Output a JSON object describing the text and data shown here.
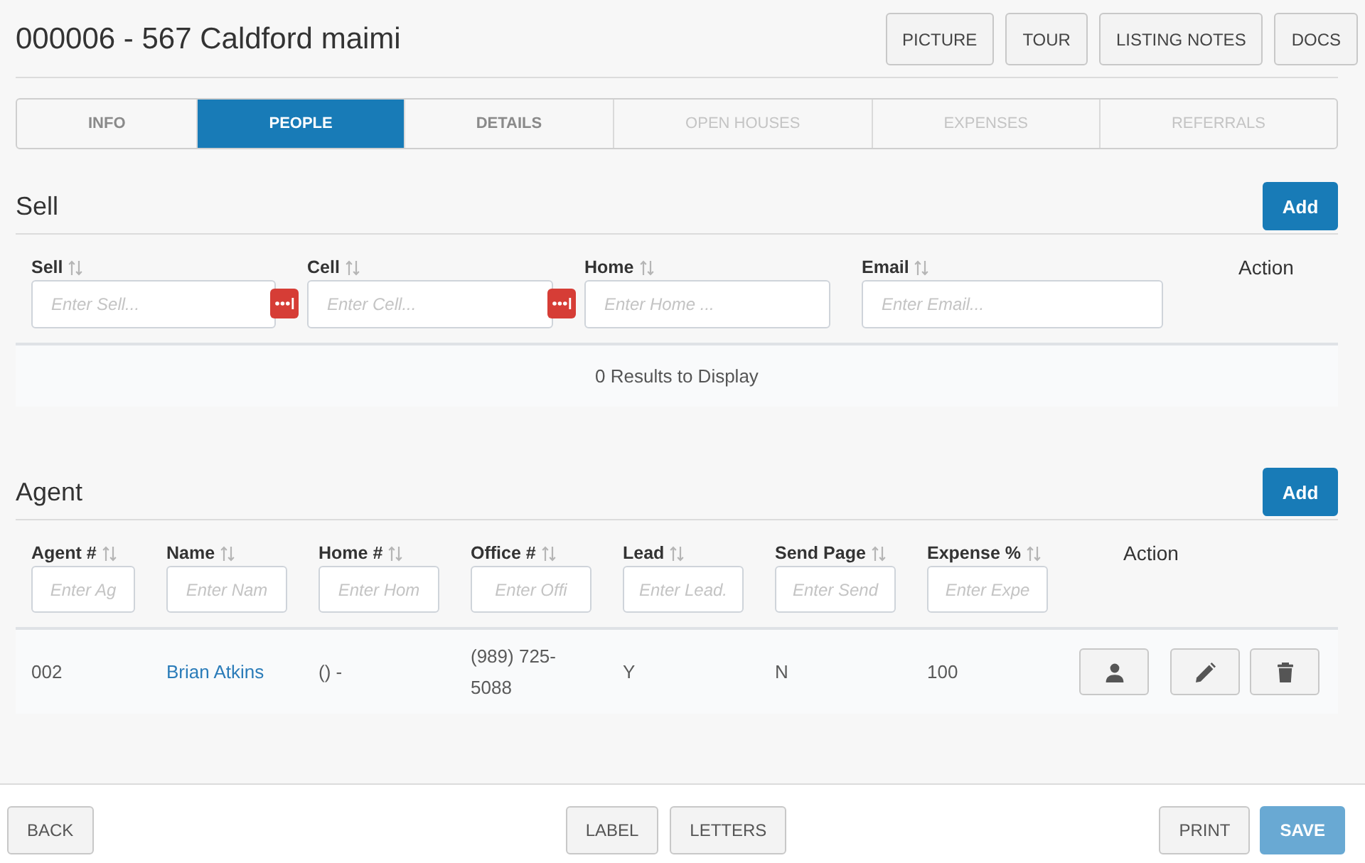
{
  "header": {
    "title": "000006 - 567 Caldford maimi",
    "buttons": [
      {
        "label": "PICTURE"
      },
      {
        "label": "TOUR"
      },
      {
        "label": "LISTING NOTES"
      },
      {
        "label": "DOCS"
      }
    ]
  },
  "tabs": [
    {
      "label": "INFO",
      "selected": false,
      "disabled": false
    },
    {
      "label": "PEOPLE",
      "selected": true,
      "disabled": false
    },
    {
      "label": "DETAILS",
      "selected": false,
      "disabled": false
    },
    {
      "label": "OPEN HOUSES",
      "selected": false,
      "disabled": true
    },
    {
      "label": "EXPENSES",
      "selected": false,
      "disabled": true
    },
    {
      "label": "REFERRALS",
      "selected": false,
      "disabled": true
    }
  ],
  "sell_section": {
    "title": "Sell",
    "add_button": "Add",
    "columns": [
      {
        "kind": "filter",
        "label": "Sell",
        "placeholder": "Enter Sell...",
        "addon": true
      },
      {
        "kind": "filter",
        "label": "Cell",
        "placeholder": "Enter Cell...",
        "addon": true
      },
      {
        "kind": "filter",
        "label": "Home",
        "placeholder": "Enter Home ...",
        "addon": false
      },
      {
        "kind": "filter",
        "label": "Email",
        "placeholder": "Enter Email...",
        "addon": false
      },
      {
        "kind": "action",
        "label": "Action"
      }
    ],
    "empty_message": "0 Results to Display"
  },
  "agent_section": {
    "title": "Agent",
    "add_button": "Add",
    "columns": [
      {
        "kind": "filter",
        "label": "Agent #",
        "placeholder": "Enter Ag",
        "addon": false
      },
      {
        "kind": "filter",
        "label": "Name",
        "placeholder": "Enter Nam",
        "addon": false
      },
      {
        "kind": "filter",
        "label": "Home #",
        "placeholder": "Enter Hom",
        "addon": false
      },
      {
        "kind": "filter",
        "label": "Office #",
        "placeholder": "Enter Offi",
        "addon": false
      },
      {
        "kind": "filter",
        "label": "Lead",
        "placeholder": "Enter Lead.",
        "addon": false
      },
      {
        "kind": "filter",
        "label": "Send Page",
        "placeholder": "Enter Send",
        "addon": false
      },
      {
        "kind": "filter",
        "label": "Expense %",
        "placeholder": "Enter Expe",
        "addon": false
      },
      {
        "kind": "action",
        "label": "Action"
      }
    ],
    "rows": [
      {
        "cells": [
          {
            "kind": "text",
            "text": "002"
          },
          {
            "kind": "link",
            "text": "Brian Atkins"
          },
          {
            "kind": "text",
            "text": "() -"
          },
          {
            "kind": "text",
            "text": "(989) 725-5088"
          },
          {
            "kind": "text",
            "text": "Y"
          },
          {
            "kind": "text",
            "text": "N"
          },
          {
            "kind": "text",
            "text": "100"
          }
        ],
        "actions": [
          {
            "kind": "person"
          },
          {
            "kind": "edit"
          },
          {
            "kind": "delete"
          }
        ]
      }
    ]
  },
  "footer": {
    "left": [
      {
        "label": "BACK",
        "kind": "default",
        "disabled": false
      }
    ],
    "center": [
      {
        "label": "LABEL",
        "kind": "default",
        "disabled": false
      },
      {
        "label": "LETTERS",
        "kind": "default",
        "disabled": false
      }
    ],
    "right": [
      {
        "label": "PRINT",
        "kind": "default",
        "disabled": false
      },
      {
        "label": "SAVE",
        "kind": "primary",
        "disabled": true
      }
    ]
  }
}
